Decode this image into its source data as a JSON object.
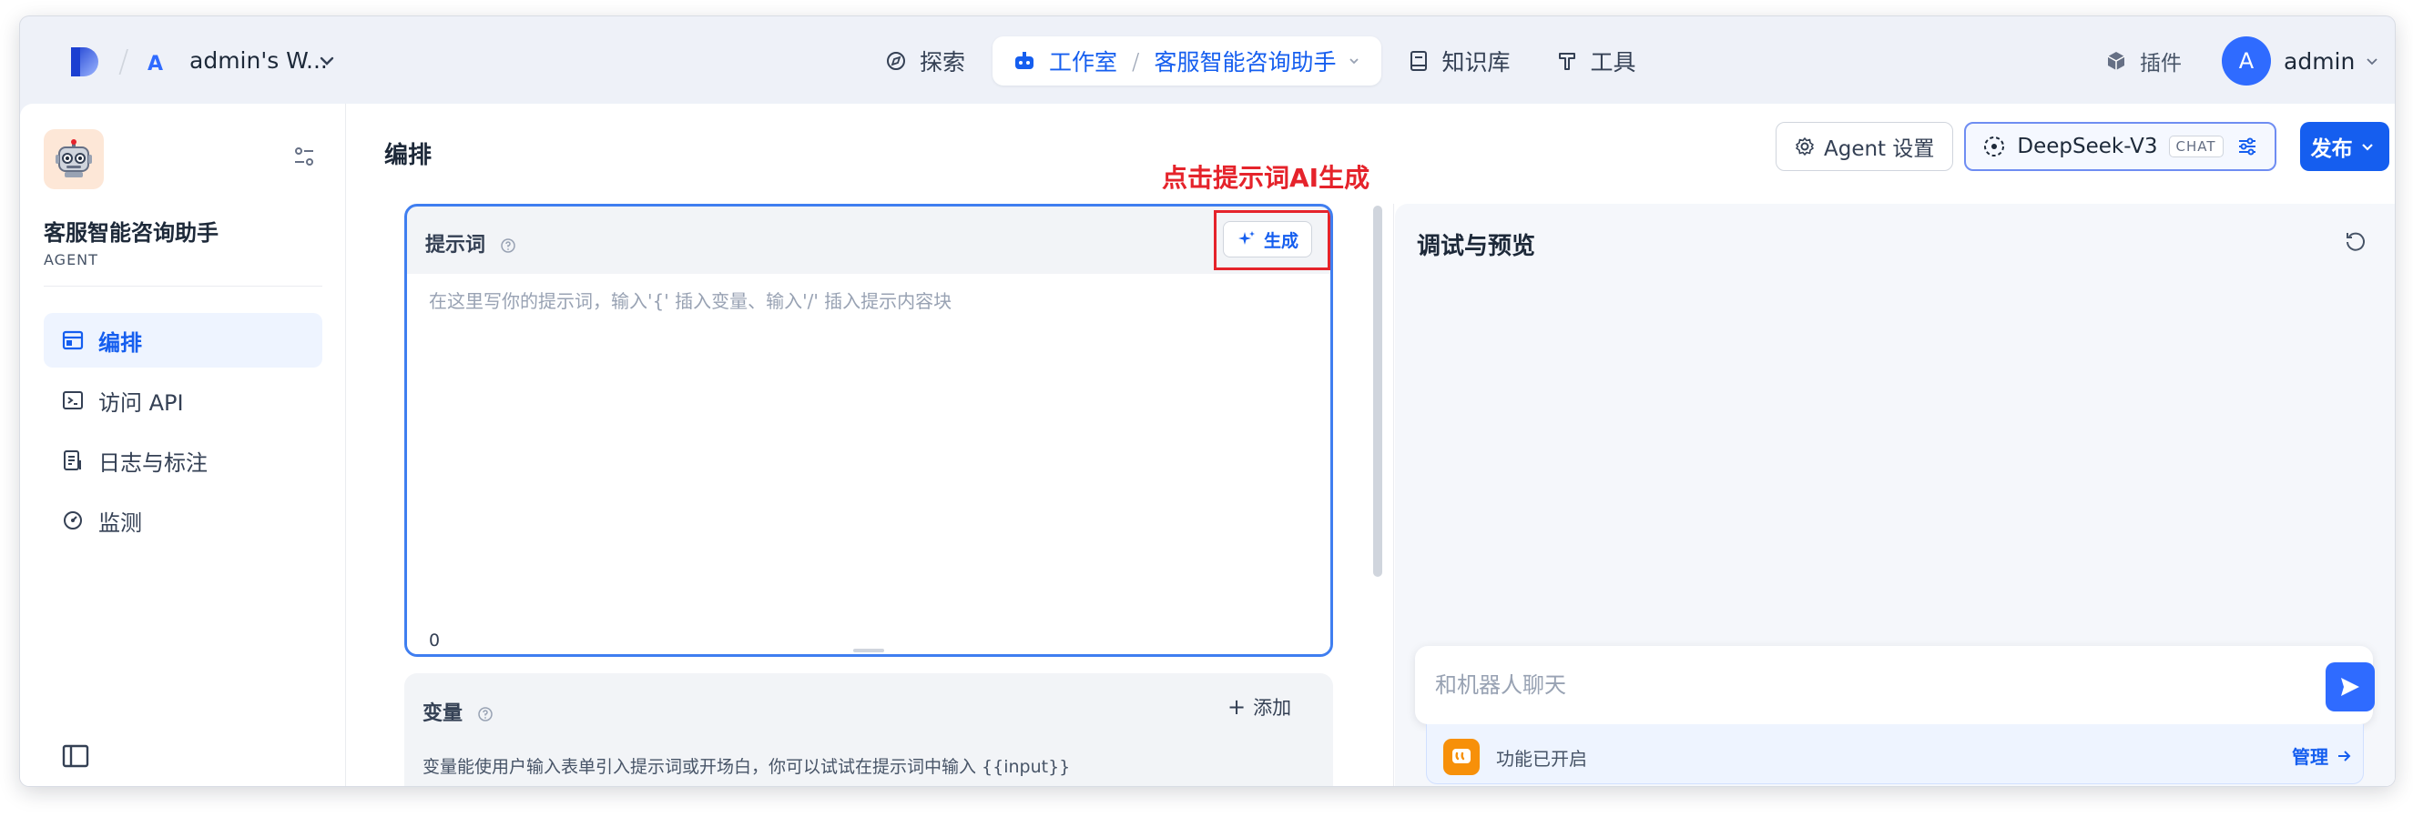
{
  "workspace": {
    "avatar_letter": "A",
    "name": "admin's W..."
  },
  "nav": {
    "explore": "探索",
    "studio": "工作室",
    "separator": "/",
    "current_app": "客服智能咨询助手",
    "knowledge": "知识库",
    "tools": "工具"
  },
  "plugins": "插件",
  "user": {
    "avatar_letter": "A",
    "name": "admin"
  },
  "app": {
    "name": "客服智能咨询助手",
    "type": "AGENT",
    "icon": "🤖"
  },
  "sidebar": {
    "items": [
      {
        "label": "编排",
        "icon": "layout-icon",
        "active": true
      },
      {
        "label": "访问 API",
        "icon": "terminal-icon",
        "active": false
      },
      {
        "label": "日志与标注",
        "icon": "log-icon",
        "active": false
      },
      {
        "label": "监测",
        "icon": "gauge-icon",
        "active": false
      }
    ]
  },
  "main": {
    "title": "编排",
    "agent_settings": "Agent 设置",
    "model": {
      "name": "DeepSeek-V3",
      "badge": "CHAT"
    },
    "publish": "发布"
  },
  "annotation": "点击提示词AI生成",
  "prompt": {
    "label": "提示词",
    "generate": "生成",
    "placeholder": "在这里写你的提示词，输入'{' 插入变量、输入'/' 插入提示内容块",
    "value": "",
    "count": "0"
  },
  "variables": {
    "label": "变量",
    "add": "添加",
    "description": "变量能使用户输入表单引入提示词或开场白，你可以试试在提示词中输入 {{input}}"
  },
  "debug": {
    "title": "调试与预览",
    "chat_placeholder": "和机器人聊天",
    "feature_text": "功能已开启",
    "manage": "管理"
  },
  "colors": {
    "accent": "#155eef",
    "highlight": "#e5232b",
    "primary_button": "#2f6bff"
  }
}
